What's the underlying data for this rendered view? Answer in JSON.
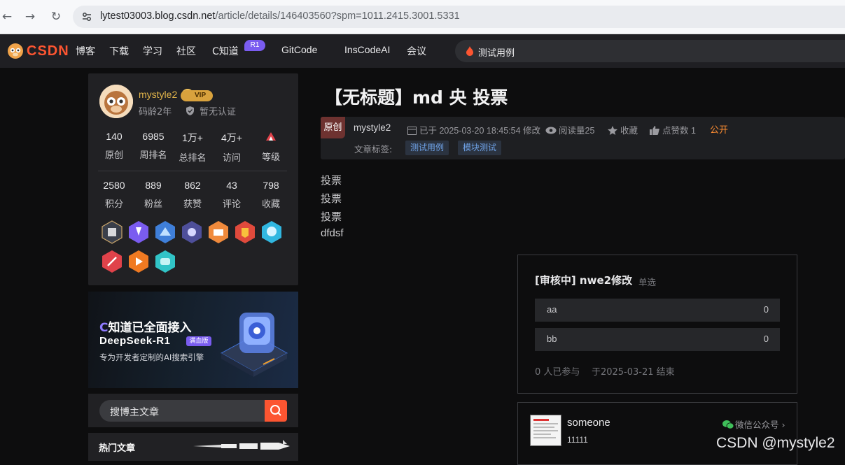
{
  "browser": {
    "url_host": "lytest03003.blog.csdn.net",
    "url_path": "/article/details/146403560?spm=1011.2415.3001.5331"
  },
  "topnav": {
    "logo": "CSDN",
    "items": [
      "博客",
      "下载",
      "学习",
      "社区",
      "C知道",
      "GitCode",
      "InsCodeAI",
      "会议"
    ],
    "r1_badge": "R1",
    "search_text": "测试用例"
  },
  "profile": {
    "username": "mystyle2",
    "vip": "VIP",
    "code_age": "码龄2年",
    "cert": "暂无认证",
    "stats_row1": [
      {
        "value": "140",
        "label": "原创"
      },
      {
        "value": "6985",
        "label": "周排名"
      },
      {
        "value": "1万+",
        "label": "总排名"
      },
      {
        "value": "4万+",
        "label": "访问"
      },
      {
        "value": "",
        "label": "等级"
      }
    ],
    "stats_row2": [
      {
        "value": "2580",
        "label": "积分"
      },
      {
        "value": "889",
        "label": "粉丝"
      },
      {
        "value": "862",
        "label": "获赞"
      },
      {
        "value": "43",
        "label": "评论"
      },
      {
        "value": "798",
        "label": "收藏"
      }
    ]
  },
  "ad": {
    "line1": "知道已全面接入",
    "line2": "DeepSeek-R1",
    "tag": "满血版",
    "line3": "专为开发者定制的AI搜索引擎"
  },
  "blog_search": {
    "placeholder": "搜博主文章"
  },
  "hot": {
    "title": "热门文章"
  },
  "article": {
    "title": "【无标题】md 央 投票",
    "original": "原创",
    "author": "mystyle2",
    "modified": "已于 2025-03-20 18:45:54 修改",
    "reads": "阅读量25",
    "collect": "收藏",
    "likes": "点赞数 1",
    "visibility": "公开",
    "tags_label": "文章标签:",
    "tags": [
      "测试用例",
      "模块测试"
    ],
    "body": [
      "投票",
      "投票",
      "投票",
      "dfdsf"
    ]
  },
  "vote": {
    "title": "[审核中] nwe2修改",
    "type": "单选",
    "options": [
      {
        "name": "aa",
        "count": "0"
      },
      {
        "name": "bb",
        "count": "0"
      }
    ],
    "participants": "0 人已参与",
    "ends": "于2025-03-21 结束"
  },
  "author_card": {
    "name": "someone",
    "sub": "11111",
    "wechat": "微信公众号"
  },
  "watermark": "CSDN @mystyle2"
}
